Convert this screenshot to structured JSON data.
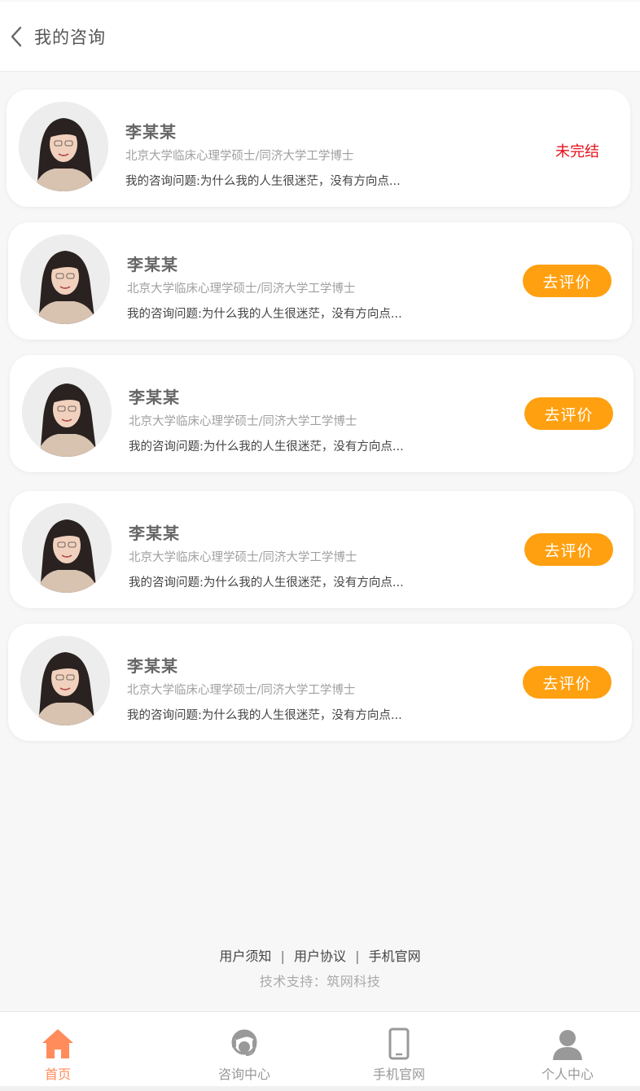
{
  "header": {
    "title": "我的咨询"
  },
  "consultations": [
    {
      "name": "李某某",
      "degree": "北京大学临床心理学硕士/同济大学工学博士",
      "question": "我的咨询问题:为什么我的人生很迷茫，没有方向点...",
      "status_label": "未完结",
      "action_label": ""
    },
    {
      "name": "李某某",
      "degree": "北京大学临床心理学硕士/同济大学工学博士",
      "question": "我的咨询问题:为什么我的人生很迷茫，没有方向点...",
      "status_label": "",
      "action_label": "去评价"
    },
    {
      "name": "李某某",
      "degree": "北京大学临床心理学硕士/同济大学工学博士",
      "question": "我的咨询问题:为什么我的人生很迷茫，没有方向点...",
      "status_label": "",
      "action_label": "去评价"
    },
    {
      "name": "李某某",
      "degree": "北京大学临床心理学硕士/同济大学工学博士",
      "question": "我的咨询问题:为什么我的人生很迷茫，没有方向点...",
      "status_label": "",
      "action_label": "去评价"
    },
    {
      "name": "李某某",
      "degree": "北京大学临床心理学硕士/同济大学工学博士",
      "question": "我的咨询问题:为什么我的人生很迷茫，没有方向点...",
      "status_label": "",
      "action_label": "去评价"
    }
  ],
  "footer": {
    "links": [
      "用户须知",
      "用户协议",
      "手机官网"
    ],
    "separator": "|",
    "support": "技术支持：筑网科技"
  },
  "tabbar": {
    "tabs": [
      {
        "label": "首页",
        "icon": "home-icon",
        "active": true
      },
      {
        "label": "咨询中心",
        "icon": "consult-icon",
        "active": false
      },
      {
        "label": "手机官网",
        "icon": "phone-icon",
        "active": false
      },
      {
        "label": "个人中心",
        "icon": "person-icon",
        "active": false
      }
    ]
  },
  "colors": {
    "accent_orange": "#ffa010",
    "status_red": "#e8101a",
    "active_tab": "#ff8c5a",
    "inactive_tab": "#999999"
  }
}
